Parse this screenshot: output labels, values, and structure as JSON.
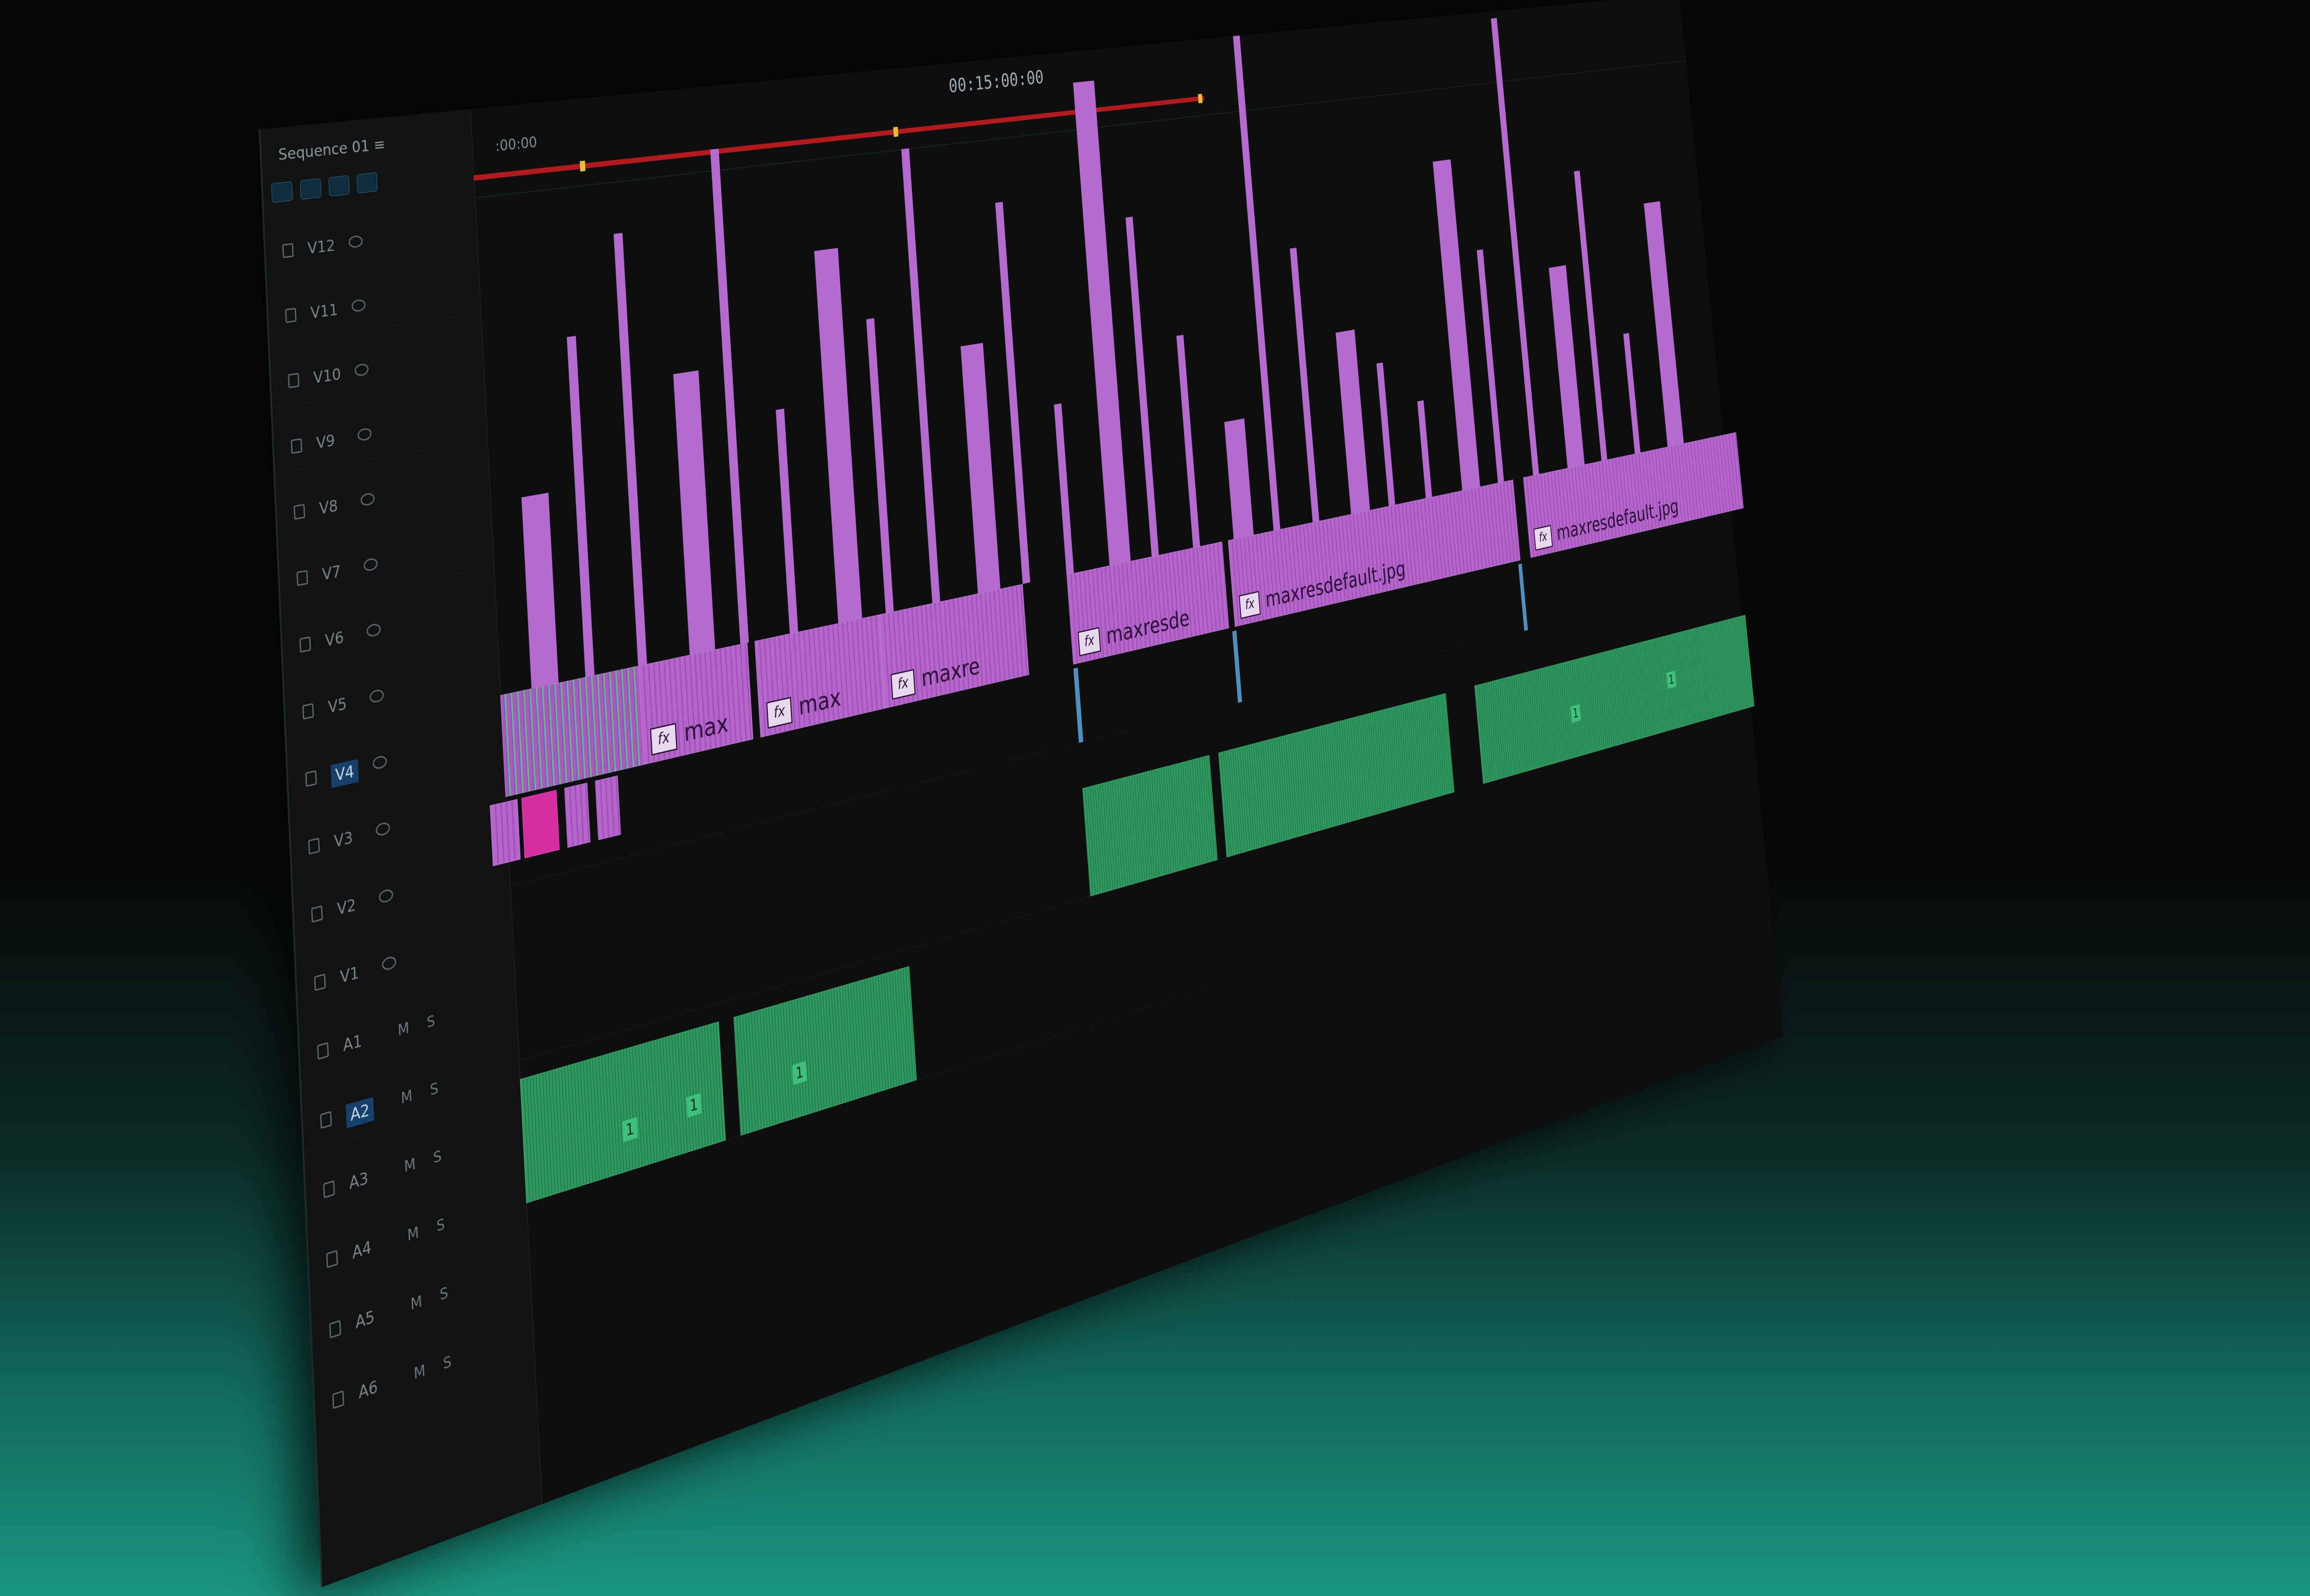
{
  "sequence": {
    "tab_label": "Sequence 01 ≡"
  },
  "ruler": {
    "start_timecode": ":00:00",
    "mid_timecode": "00:15:00:00"
  },
  "tracks": [
    {
      "label": "V12"
    },
    {
      "label": "V11"
    },
    {
      "label": "V10"
    },
    {
      "label": "V9"
    },
    {
      "label": "V8"
    },
    {
      "label": "V7"
    },
    {
      "label": "V6"
    },
    {
      "label": "V5"
    },
    {
      "label": "V4"
    },
    {
      "label": "V3"
    },
    {
      "label": "V2"
    },
    {
      "label": "V1"
    },
    {
      "label": "A1"
    },
    {
      "label": "A2"
    },
    {
      "label": "A3"
    },
    {
      "label": "A4"
    },
    {
      "label": "A5"
    },
    {
      "label": "A6"
    }
  ],
  "track_toggles": {
    "mute": "M",
    "solo": "S"
  },
  "clips": {
    "fx_icon": "fx",
    "labels": [
      "max",
      "max",
      "maxre",
      "maxresde",
      "maxresdefault.jpg",
      "maxresdefault.jpg"
    ],
    "audio_number": "1"
  },
  "colors": {
    "video_clip": "#b466cc",
    "audio_clip": "#2e9a5e",
    "work_area_bar": "#b3191d",
    "selected_track": "#16406a"
  }
}
